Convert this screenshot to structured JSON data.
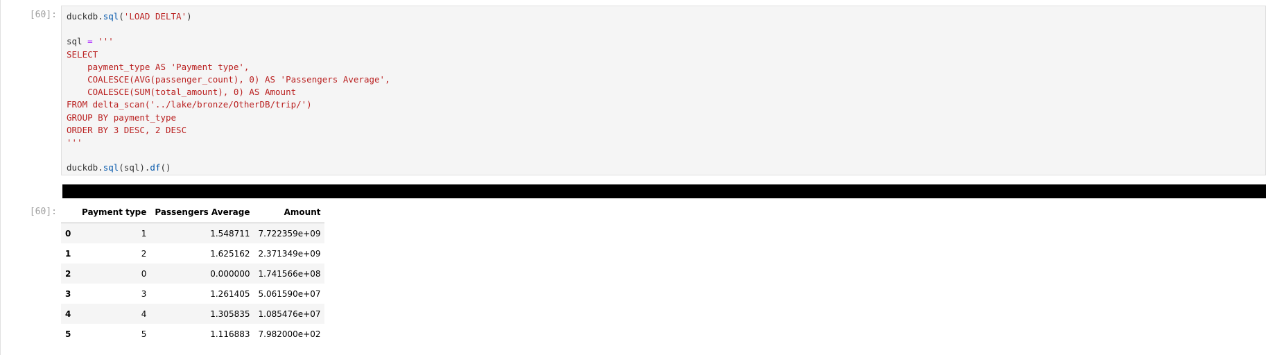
{
  "input_prompt": "[60]:",
  "output_prompt": "[60]:",
  "code_lines": [
    [
      {
        "t": "duckdb.",
        "c": "plain"
      },
      {
        "t": "sql",
        "c": "fn"
      },
      {
        "t": "(",
        "c": "plain"
      },
      {
        "t": "'LOAD DELTA'",
        "c": "str"
      },
      {
        "t": ")",
        "c": "plain"
      }
    ],
    [],
    [
      {
        "t": "sql ",
        "c": "plain"
      },
      {
        "t": "=",
        "c": "op"
      },
      {
        "t": " ",
        "c": "plain"
      },
      {
        "t": "'''",
        "c": "str"
      }
    ],
    [
      {
        "t": "SELECT",
        "c": "str"
      }
    ],
    [
      {
        "t": "    payment_type AS 'Payment type',",
        "c": "str"
      }
    ],
    [
      {
        "t": "    COALESCE(AVG(passenger_count), 0) AS 'Passengers Average',",
        "c": "str"
      }
    ],
    [
      {
        "t": "    COALESCE(SUM(total_amount), 0) AS Amount",
        "c": "str"
      }
    ],
    [
      {
        "t": "FROM delta_scan('../lake/bronze/OtherDB/trip/')",
        "c": "str"
      }
    ],
    [
      {
        "t": "GROUP BY payment_type",
        "c": "str"
      }
    ],
    [
      {
        "t": "ORDER BY 3 DESC, 2 DESC",
        "c": "str"
      }
    ],
    [
      {
        "t": "'''",
        "c": "str"
      }
    ],
    [],
    [
      {
        "t": "duckdb.",
        "c": "plain"
      },
      {
        "t": "sql",
        "c": "fn"
      },
      {
        "t": "(sql).",
        "c": "plain"
      },
      {
        "t": "df",
        "c": "fn"
      },
      {
        "t": "()",
        "c": "plain"
      }
    ]
  ],
  "table": {
    "columns": [
      "",
      "Payment type",
      "Passengers Average",
      "Amount"
    ],
    "rows": [
      [
        "0",
        "1",
        "1.548711",
        "7.722359e+09"
      ],
      [
        "1",
        "2",
        "1.625162",
        "2.371349e+09"
      ],
      [
        "2",
        "0",
        "0.000000",
        "1.741566e+08"
      ],
      [
        "3",
        "3",
        "1.261405",
        "5.061590e+07"
      ],
      [
        "4",
        "4",
        "1.305835",
        "1.085476e+07"
      ],
      [
        "5",
        "5",
        "1.116883",
        "7.982000e+02"
      ]
    ]
  }
}
